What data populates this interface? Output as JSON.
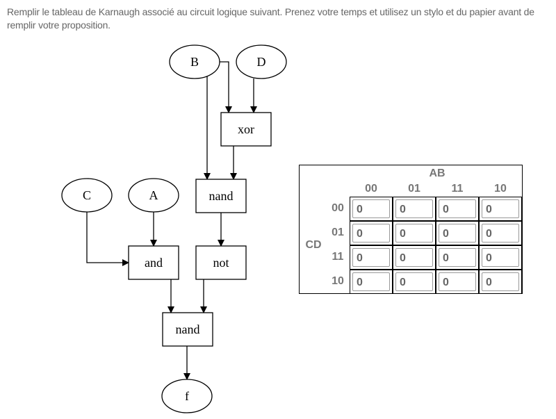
{
  "instructions": "Remplir le tableau de Karnaugh associé au circuit logique suivant. Prenez votre temps et utilisez un stylo et du papier avant de remplir votre proposition.",
  "circuit": {
    "inputs": {
      "B": "B",
      "D": "D",
      "C": "C",
      "A": "A"
    },
    "gates": {
      "xor": "xor",
      "nand1": "nand",
      "and": "and",
      "not": "not",
      "nand2": "nand"
    },
    "output": "f"
  },
  "kmap": {
    "col_var": "AB",
    "row_var": "CD",
    "col_headers": [
      "00",
      "01",
      "11",
      "10"
    ],
    "row_headers": [
      "00",
      "01",
      "11",
      "10"
    ],
    "values": [
      [
        "0",
        "0",
        "0",
        "0"
      ],
      [
        "0",
        "0",
        "0",
        "0"
      ],
      [
        "0",
        "0",
        "0",
        "0"
      ],
      [
        "0",
        "0",
        "0",
        "0"
      ]
    ]
  }
}
